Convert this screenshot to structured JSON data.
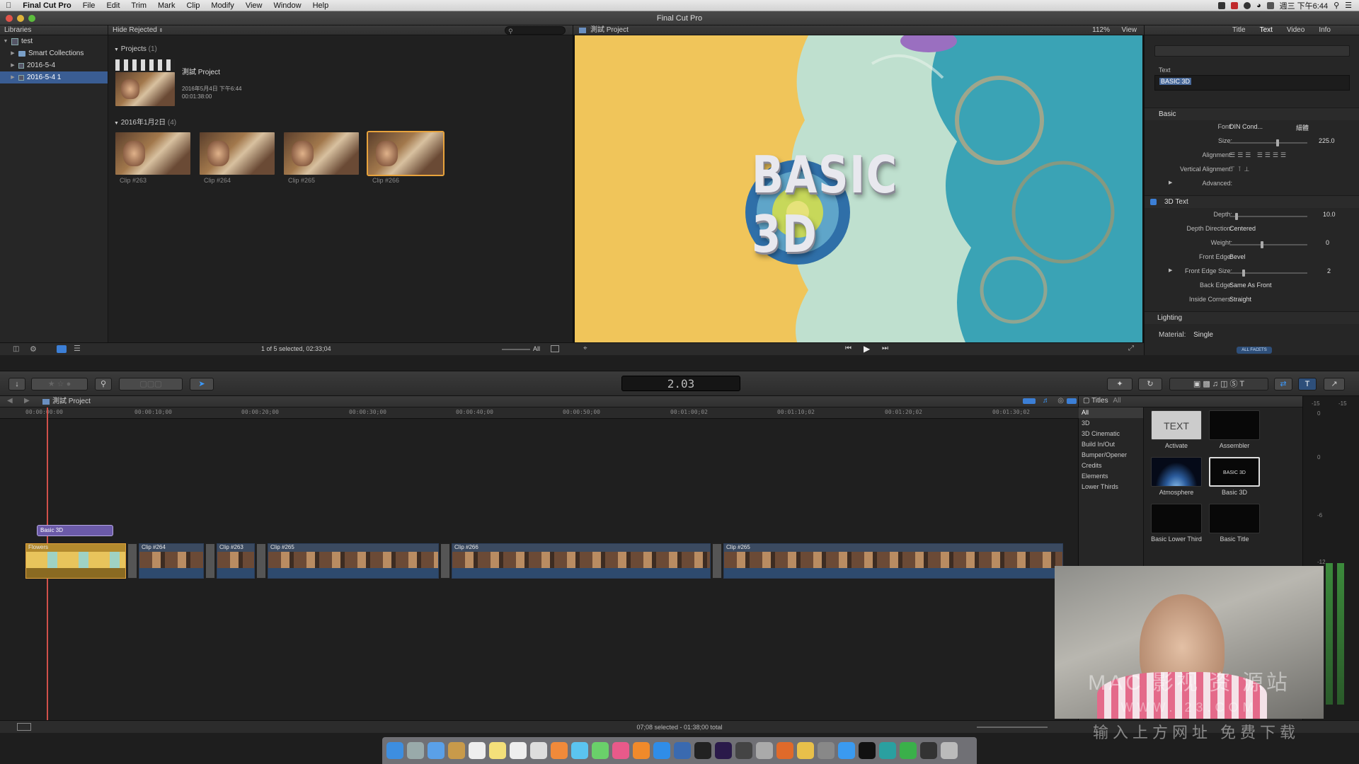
{
  "menubar": {
    "app": "Final Cut Pro",
    "items": [
      "File",
      "Edit",
      "Trim",
      "Mark",
      "Clip",
      "Modify",
      "View",
      "Window",
      "Help"
    ],
    "clock": "週三 下午6:44"
  },
  "window": {
    "title": "Final Cut Pro"
  },
  "libraries": {
    "header": "Libraries",
    "items": [
      {
        "label": "test"
      },
      {
        "label": "Smart Collections"
      },
      {
        "label": "2016-5-4"
      },
      {
        "label": "2016-5-4 1"
      }
    ]
  },
  "browser": {
    "filter": "Hide Rejected",
    "projects_label": "Projects",
    "projects_count": "(1)",
    "project": {
      "name": "測試 Project",
      "date": "2016年5月4日 下午6:44",
      "duration": "00:01:38:00"
    },
    "date_group": "2016年1月2日",
    "date_count": "(4)",
    "clips": [
      "Clip #263",
      "Clip #264",
      "Clip #265",
      "Clip #266"
    ],
    "status": "1 of 5 selected, 02:33;04",
    "all_label": "All"
  },
  "viewer": {
    "title": "測試 Project",
    "zoom": "112%",
    "view_label": "View",
    "overlay_text": "BASIC 3D"
  },
  "inspector": {
    "tabs": [
      "Title",
      "Text",
      "Video",
      "Info"
    ],
    "text_label": "Text",
    "text_value": "BASIC 3D",
    "basic": "Basic",
    "font_label": "Font:",
    "font_value": "DIN Cond...",
    "font_weight": "細體",
    "size_label": "Size:",
    "size_value": "225.0",
    "alignment_label": "Alignment:",
    "valign_label": "Vertical Alignment:",
    "advanced_label": "Advanced:",
    "text3d": "3D Text",
    "depth_label": "Depth:",
    "depth_value": "10.0",
    "depthdir_label": "Depth Direction:",
    "depthdir_value": "Centered",
    "weight_label": "Weight:",
    "weight_value": "0",
    "frontedge_label": "Front Edge:",
    "frontedge_value": "Bevel",
    "frontedgesize_label": "Front Edge Size:",
    "frontedgesize_value": "2",
    "backedge_label": "Back Edge:",
    "backedge_value": "Same As Front",
    "corners_label": "Inside Corners:",
    "corners_value": "Straight",
    "lighting": "Lighting",
    "material_label": "Material:",
    "material_value": "Single",
    "facets": "ALL FACETS"
  },
  "toolbar": {
    "timecode": "2.03"
  },
  "timeline": {
    "project": "測試 Project",
    "ticks": [
      "00:00:00:00",
      "00:00:10;00",
      "00:00:20;00",
      "00:00:30;00",
      "00:00:40;00",
      "00:00:50;00",
      "00:01:00;02",
      "00:01:10;02",
      "00:01:20;02",
      "00:01:30;02"
    ],
    "title_clip": "Basic 3D",
    "clips": [
      {
        "label": "Flowers"
      },
      {
        "label": "Clip #264"
      },
      {
        "label": "Clip #263"
      },
      {
        "label": "Clip #265"
      },
      {
        "label": "Clip #266"
      },
      {
        "label": "Clip #265"
      }
    ],
    "status": "07;08 selected - 01:38;00 total"
  },
  "titles": {
    "header": "Titles",
    "all": "All",
    "categories": [
      "All",
      "3D",
      "3D Cinematic",
      "Build In/Out",
      "Bumper/Opener",
      "Credits",
      "Elements",
      "Lower Thirds"
    ],
    "items": [
      {
        "label": "Activate",
        "thumb": "TEXT"
      },
      {
        "label": "Assembler",
        "thumb": ""
      },
      {
        "label": "Atmosphere",
        "thumb": ""
      },
      {
        "label": "Basic 3D",
        "thumb": "BASIC 3D"
      },
      {
        "label": "Basic Lower Third",
        "thumb": ""
      },
      {
        "label": "Basic Title",
        "thumb": ""
      }
    ]
  },
  "meter": {
    "labels": [
      "-15",
      "-15",
      "0",
      "0",
      "-6",
      "-12"
    ]
  },
  "watermark": {
    "line1": "MAC 影视 资 源站",
    "line2": "WWW.       23.COM",
    "line3": "输入上方网址 免费下载"
  },
  "colors": {
    "selection": "#3a5d93",
    "accent_blue": "#3c7fd6",
    "clip_blue": "#3b4a60",
    "title_purple": "#6b5aa8",
    "flowers_yellow": "#e2a23c"
  }
}
